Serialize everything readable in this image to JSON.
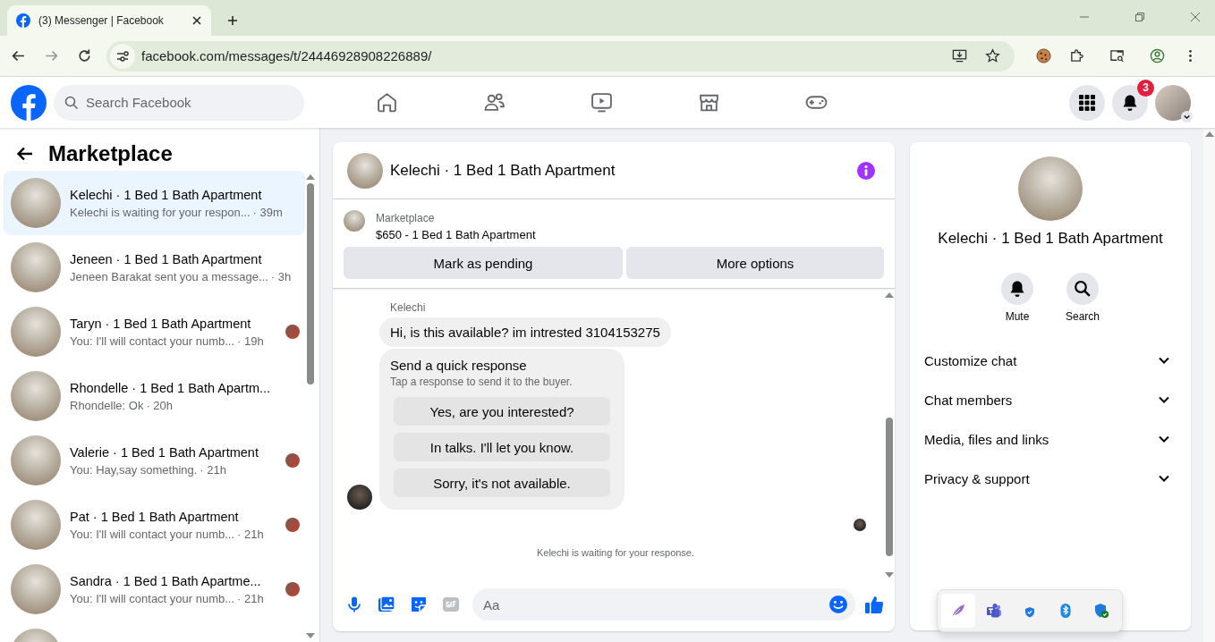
{
  "browser": {
    "tab": {
      "title": "(3) Messenger | Facebook"
    },
    "url": "facebook.com/messages/t/24446928908226889/"
  },
  "header": {
    "search": {
      "placeholder": "Search Facebook"
    },
    "notifications": {
      "count": "3"
    }
  },
  "sidebar": {
    "title": "Marketplace",
    "conversations": [
      {
        "title": "Kelechi · 1 Bed 1 Bath Apartment",
        "preview": "Kelechi is waiting for your respon...",
        "time": "· 39m",
        "selected": true,
        "seen": false
      },
      {
        "title": "Jeneen · 1 Bed 1 Bath Apartment",
        "preview": "Jeneen Barakat sent you a message...",
        "time": "· 3h",
        "selected": false,
        "seen": false
      },
      {
        "title": "Taryn · 1 Bed 1 Bath Apartment",
        "preview": "You: I'll will contact your numb...",
        "time": "· 19h",
        "selected": false,
        "seen": true
      },
      {
        "title": "Rhondelle · 1 Bed 1 Bath Apartm...",
        "preview": "Rhondelle: Ok",
        "time": "· 20h",
        "selected": false,
        "seen": false
      },
      {
        "title": "Valerie · 1 Bed 1 Bath Apartment",
        "preview": "You: Hay,say something.",
        "time": "· 21h",
        "selected": false,
        "seen": true
      },
      {
        "title": "Pat · 1 Bed 1 Bath Apartment",
        "preview": "You: I'll will contact your numb...",
        "time": "· 21h",
        "selected": false,
        "seen": true
      },
      {
        "title": "Sandra · 1 Bed 1 Bath Apartme...",
        "preview": "You: I'll will contact your numb...",
        "time": "· 21h",
        "selected": false,
        "seen": true
      }
    ]
  },
  "chat": {
    "title": "Kelechi · 1 Bed 1 Bath Apartment",
    "listing": {
      "label": "Marketplace",
      "name": "$650 - 1 Bed 1 Bath Apartment",
      "buttons": [
        "Mark as pending",
        "More options"
      ]
    },
    "messages": [
      {
        "sender": "Kelechi",
        "text": "Hi, is this available? im intrested 3104153275"
      }
    ],
    "quick_response": {
      "title": "Send a quick response",
      "subtitle": "Tap a response to send it to the buyer.",
      "options": [
        "Yes, are you interested?",
        "In talks. I'll let you know.",
        "Sorry, it's not available."
      ]
    },
    "status": "Kelechi is waiting for your response.",
    "composer": {
      "placeholder": "Aa"
    }
  },
  "details": {
    "name": "Kelechi · 1 Bed 1 Bath Apartment",
    "actions": [
      {
        "kind": "bell",
        "label": "Mute"
      },
      {
        "kind": "search",
        "label": "Search"
      }
    ],
    "sections": [
      {
        "label": "Customize chat",
        "expanded": false
      },
      {
        "label": "Chat members",
        "expanded": false
      },
      {
        "label": "Media, files and links",
        "expanded": false
      },
      {
        "label": "Privacy & support",
        "expanded": false
      }
    ]
  }
}
